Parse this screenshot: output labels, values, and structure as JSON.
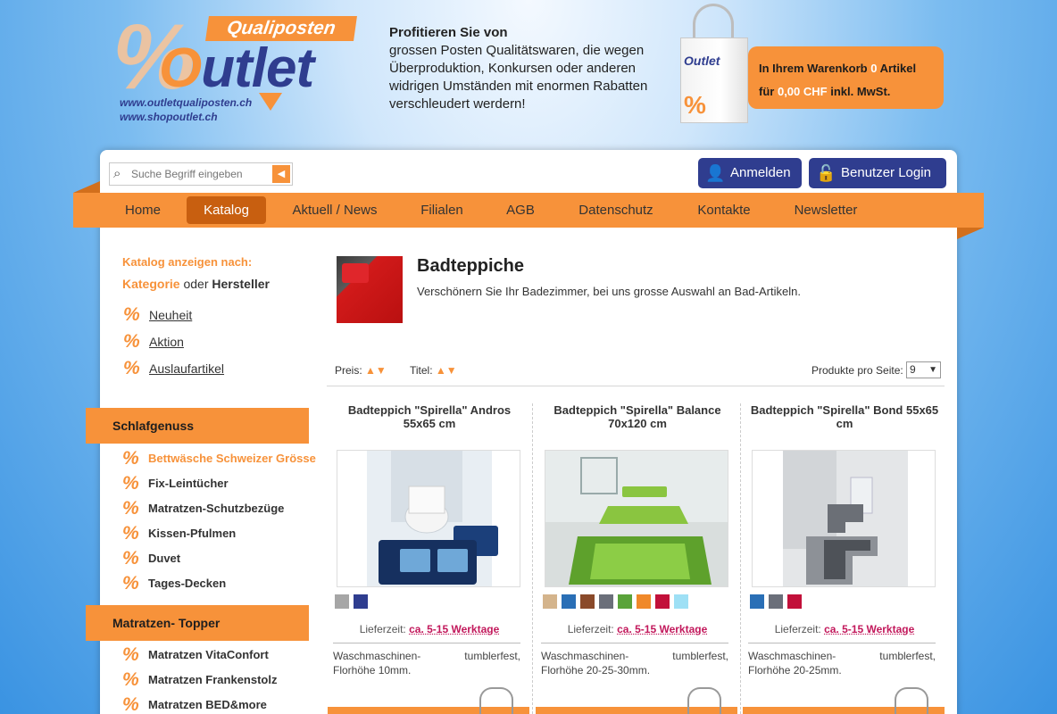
{
  "header": {
    "logo_badge": "Qualiposten",
    "logo_percent": "%",
    "logo_word_o": "O",
    "logo_word_rest": "utlet",
    "url1": "www.outletqualiposten.ch",
    "url2": "www.shopoutlet.ch",
    "tagline_bold": "Profitieren Sie von",
    "tagline_text": "grossen Posten Qualitätswaren, die wegen Überproduktion,  Konkursen oder anderen widrigen Umständen mit enormen Rabatten verschleudert werdern!",
    "bag_label": "Outlet",
    "bag_pct": "%",
    "cart_prefix": "In Ihrem Warenkorb",
    "cart_count": "0",
    "cart_suffix": "Artikel",
    "cart_total_prefix": "für",
    "cart_total": "0,00 CHF",
    "cart_total_suffix": "inkl. MwSt."
  },
  "search": {
    "placeholder": "Suche Begriff eingeben",
    "value": "Suche Begriff eingeben",
    "button_glyph": "◀"
  },
  "auth": {
    "anmelden": "Anmelden",
    "login": "Benutzer Login"
  },
  "nav": [
    {
      "label": "Home",
      "active": false
    },
    {
      "label": "Katalog",
      "active": true
    },
    {
      "label": "Aktuell / News",
      "active": false
    },
    {
      "label": "Filialen",
      "active": false
    },
    {
      "label": "AGB",
      "active": false
    },
    {
      "label": "Datenschutz",
      "active": false
    },
    {
      "label": "Kontakte",
      "active": false
    },
    {
      "label": "Newsletter",
      "active": false
    }
  ],
  "sidebar": {
    "heading": "Katalog anzeigen nach:",
    "sort_kategorie": "Kategorie",
    "sort_oder": "oder",
    "sort_hersteller": "Hersteller",
    "quick_links": [
      "Neuheit",
      "Aktion",
      "Auslaufartikel"
    ],
    "pct_glyph": "%",
    "groups": [
      {
        "title": "Schlafgenuss",
        "items": [
          "Bettwäsche Schweizer Grösse",
          "Fix-Leintücher",
          "Matratzen-Schutzbezüge",
          "Kissen-Pfulmen",
          "Duvet",
          "Tages-Decken"
        ]
      },
      {
        "title": "Matratzen- Topper",
        "items": [
          "Matratzen VitaConfort",
          "Matratzen Frankenstolz",
          "Matratzen BED&more"
        ]
      }
    ]
  },
  "category": {
    "title": "Badteppiche",
    "description": "Verschönern Sie Ihr Badezimmer, bei uns grosse Auswahl an Bad-Artikeln."
  },
  "toolbar": {
    "sort_price": "Preis:",
    "sort_title": "Titel:",
    "sort_arrows": "▲▼",
    "per_page_label": "Produkte pro Seite:",
    "per_page_value": "9"
  },
  "products": [
    {
      "title": "Badteppich \"Spirella\" Andros 55x65 cm",
      "swatches": [
        "#a6a6a6",
        "#2f3d8f"
      ],
      "lieferzeit_label": "Lieferzeit:",
      "lieferzeit_value": "ca. 5-15 Werktage",
      "description": "Waschmaschinen- tumblerfest, Florhöhe 10mm."
    },
    {
      "title": "Badteppich \"Spirella\" Balance 70x120 cm",
      "swatches": [
        "#d4b48c",
        "#2a6fb6",
        "#8a4a2a",
        "#6b6f7a",
        "#5aa33a",
        "#f0892a",
        "#c2103a",
        "#9ee0f5"
      ],
      "lieferzeit_label": "Lieferzeit:",
      "lieferzeit_value": "ca. 5-15 Werktage",
      "description": "Waschmaschinen- tumblerfest, Florhöhe 20-25-30mm."
    },
    {
      "title": "Badteppich \"Spirella\" Bond 55x65 cm",
      "swatches": [
        "#2a6fb6",
        "#6b6f7a",
        "#c2103a"
      ],
      "lieferzeit_label": "Lieferzeit:",
      "lieferzeit_value": "ca. 5-15 Werktage",
      "description": "Waschmaschinen- tumblerfest, Florhöhe 20-25mm."
    }
  ]
}
